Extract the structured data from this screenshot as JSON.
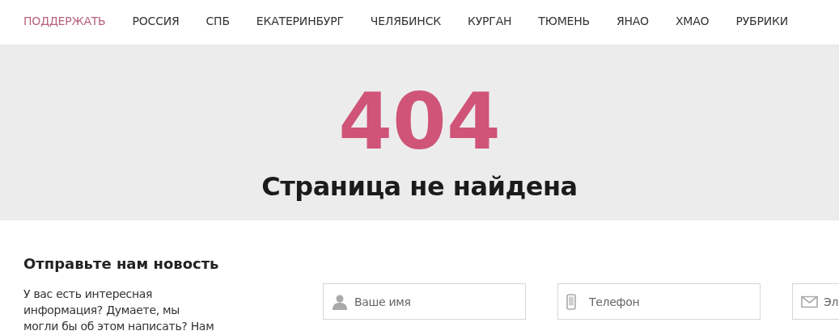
{
  "nav": [
    {
      "label": "ПОДДЕРЖАТЬ",
      "selected": true
    },
    {
      "label": "РОССИЯ",
      "selected": false
    },
    {
      "label": "СПБ",
      "selected": false
    },
    {
      "label": "ЕКАТЕРИНБУРГ",
      "selected": false
    },
    {
      "label": "ЧЕЛЯБИНСК",
      "selected": false
    },
    {
      "label": "КУРГАН",
      "selected": false
    },
    {
      "label": "ТЮМЕНЬ",
      "selected": false
    },
    {
      "label": "ЯНАО",
      "selected": false
    },
    {
      "label": "ХМАО",
      "selected": false
    },
    {
      "label": "РУБРИКИ",
      "selected": false
    }
  ],
  "error": {
    "code": "404",
    "message": "Страница не найдена"
  },
  "news_form": {
    "title": "Отправьте нам новость",
    "text": "У вас есть интересная информация? Думаете, мы могли бы об этом написать? Нам",
    "fields": [
      {
        "kind": "person",
        "placeholder": "Ваше имя"
      },
      {
        "kind": "phone",
        "placeholder": "Телефон"
      },
      {
        "kind": "mail",
        "placeholder": "Эл"
      }
    ]
  }
}
